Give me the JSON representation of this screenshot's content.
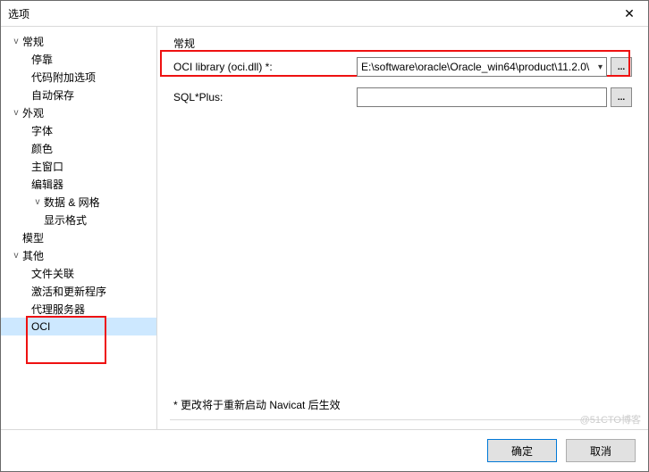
{
  "window": {
    "title": "选项",
    "close": "✕"
  },
  "tree": {
    "items": [
      {
        "label": "常规",
        "level": 0,
        "exp": "v"
      },
      {
        "label": "停靠",
        "level": 1,
        "exp": ""
      },
      {
        "label": "代码附加选项",
        "level": 1,
        "exp": ""
      },
      {
        "label": "自动保存",
        "level": 1,
        "exp": ""
      },
      {
        "label": "外观",
        "level": 0,
        "exp": "v"
      },
      {
        "label": "字体",
        "level": 1,
        "exp": ""
      },
      {
        "label": "颜色",
        "level": 1,
        "exp": ""
      },
      {
        "label": "主窗口",
        "level": 1,
        "exp": ""
      },
      {
        "label": "编辑器",
        "level": 1,
        "exp": ""
      },
      {
        "label": "数据 & 网格",
        "level": 1,
        "exp": "v"
      },
      {
        "label": "显示格式",
        "level": 2,
        "exp": ""
      },
      {
        "label": "模型",
        "level": 0,
        "exp": ""
      },
      {
        "label": "其他",
        "level": 0,
        "exp": "v"
      },
      {
        "label": "文件关联",
        "level": 1,
        "exp": ""
      },
      {
        "label": "激活和更新程序",
        "level": 1,
        "exp": ""
      },
      {
        "label": "代理服务器",
        "level": 1,
        "exp": ""
      },
      {
        "label": "OCI",
        "level": 1,
        "exp": "",
        "selected": true
      }
    ]
  },
  "content": {
    "group_title": "常规",
    "oci_label": "OCI library (oci.dll) *:",
    "oci_value": "E:\\software\\oracle\\Oracle_win64\\product\\11.2.0\\",
    "sqlplus_label": "SQL*Plus:",
    "sqlplus_value": "",
    "browse": "...",
    "note": "* 更改将于重新启动 Navicat 后生效"
  },
  "buttons": {
    "ok": "确定",
    "cancel": "取消"
  },
  "watermark": "@51CTO博客"
}
